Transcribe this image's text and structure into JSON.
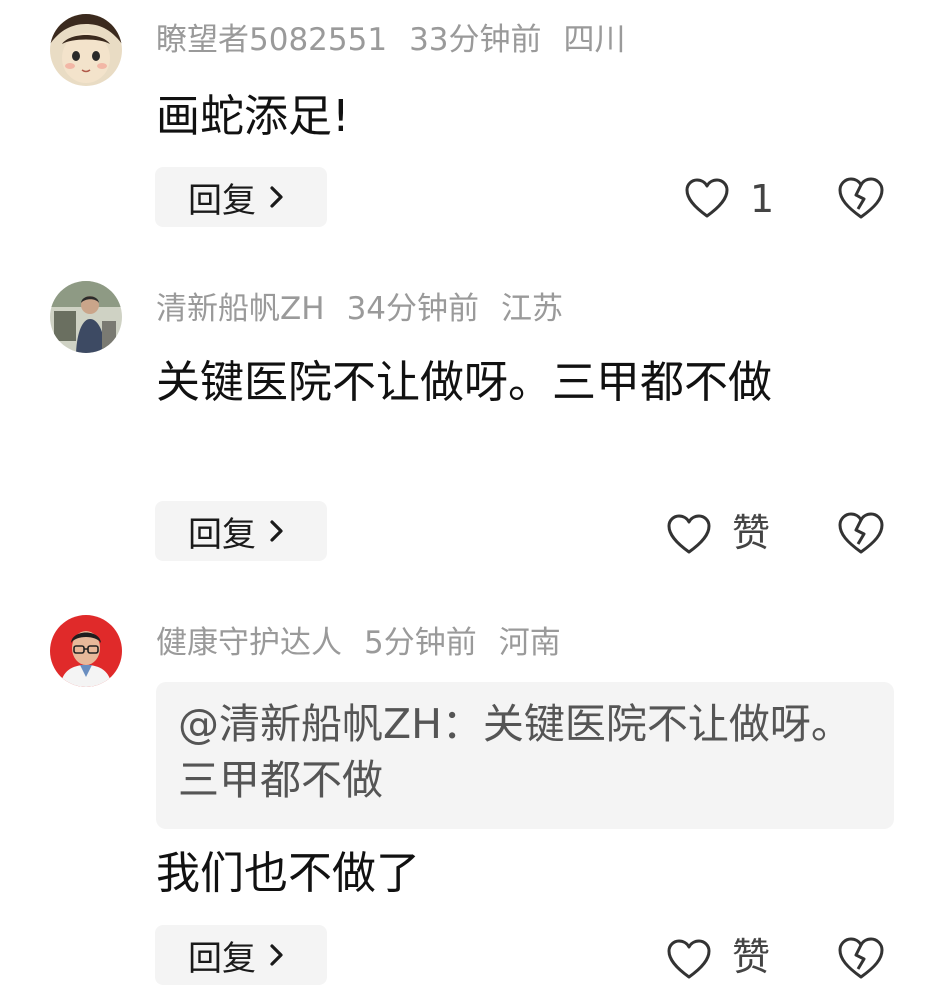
{
  "comments": [
    {
      "username": "瞭望者5082551",
      "time": "33分钟前",
      "location": "四川",
      "text": "画蛇添足!",
      "reply_label": "回复",
      "like_count": "1",
      "avatar_icon": "cartoon-face-avatar"
    },
    {
      "username": "清新船帆ZH",
      "time": "34分钟前",
      "location": "江苏",
      "text": "关键医院不让做呀。三甲都不做",
      "reply_label": "回复",
      "like_count": "赞",
      "avatar_icon": "photo-avatar"
    },
    {
      "username": "健康守护达人",
      "time": "5分钟前",
      "location": "河南",
      "quote": "@清新船帆ZH：关键医院不让做呀。三甲都不做",
      "text": "我们也不做了",
      "reply_label": "回复",
      "like_count": "赞",
      "avatar_icon": "portrait-avatar"
    }
  ],
  "colors": {
    "meta_text": "#9a9a9a",
    "reply_bg": "#f4f4f4",
    "avatar3_bg": "#e02a2a"
  }
}
